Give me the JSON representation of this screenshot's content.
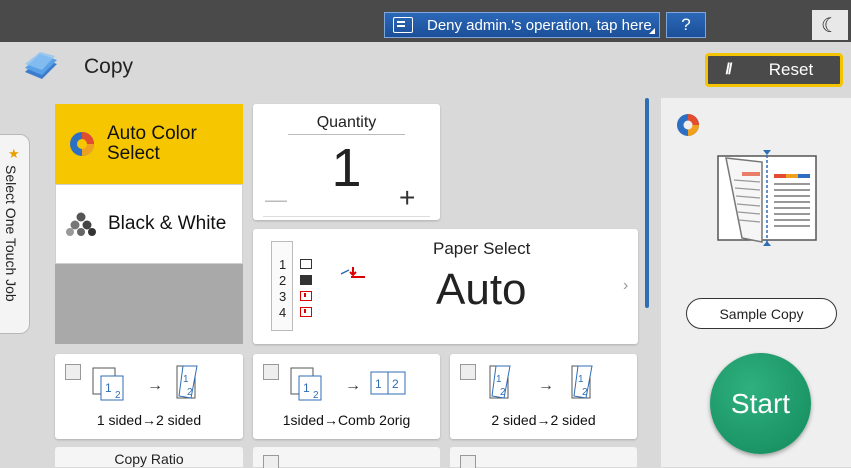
{
  "topbar": {
    "deny_label": "Deny admin.'s operation, tap here",
    "help_label": "?",
    "moon_glyph": "☾"
  },
  "header": {
    "title": "Copy",
    "reset_label": "Reset",
    "reset_glyph": "//"
  },
  "side_tab": {
    "label": "Select One Touch Job"
  },
  "color_mode": {
    "auto_color_label": "Auto Color Select",
    "bw_label": "Black & White",
    "selected": "Auto Color Select"
  },
  "quantity": {
    "title": "Quantity",
    "value": "1",
    "minus": "—",
    "plus": "+"
  },
  "paper": {
    "title": "Paper Select",
    "value": "Auto",
    "chevron": "›",
    "trays": [
      "1",
      "2",
      "3",
      "4"
    ]
  },
  "right_panel": {
    "sample_label": "Sample Copy",
    "start_label": "Start"
  },
  "duplex": [
    {
      "label": "1 sided→2 sided"
    },
    {
      "label": "1sided→Comb 2orig"
    },
    {
      "label": "2 sided→2 sided"
    }
  ],
  "bottom_row": {
    "copy_ratio_label": "Copy Ratio"
  },
  "colors": {
    "selected": "#f6c700",
    "accent": "#2f6db5",
    "start": "#1a9a68",
    "topbar": "#4a4a4a"
  }
}
